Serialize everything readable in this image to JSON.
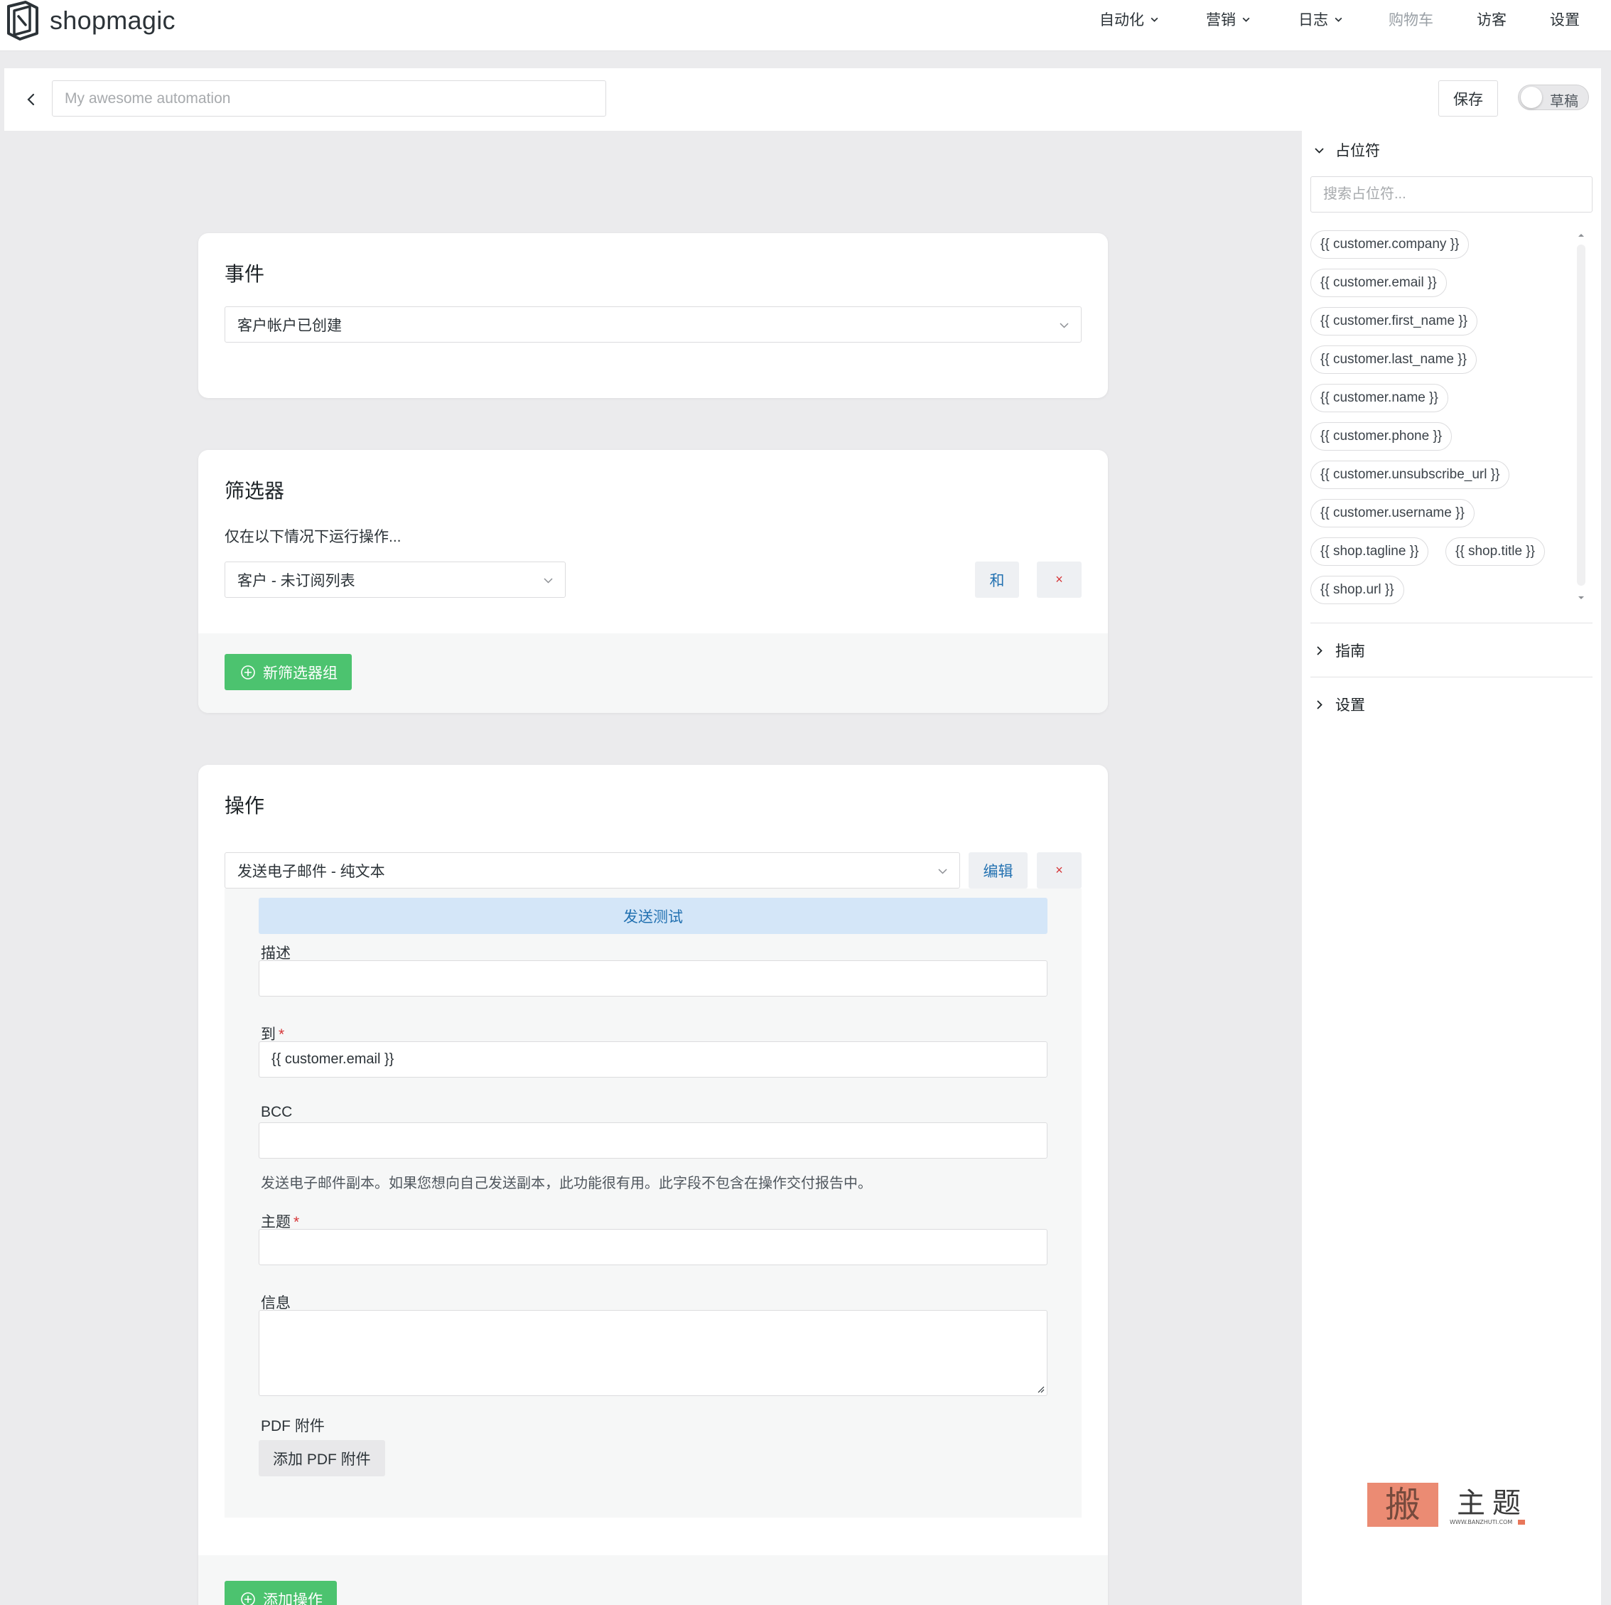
{
  "brand": {
    "name": "shopmagic"
  },
  "nav": {
    "items": [
      {
        "label": "自动化",
        "dropdown": true,
        "disabled": false
      },
      {
        "label": "营销",
        "dropdown": true,
        "disabled": false
      },
      {
        "label": "日志",
        "dropdown": true,
        "disabled": false
      },
      {
        "label": "购物车",
        "dropdown": false,
        "disabled": true
      },
      {
        "label": "访客",
        "dropdown": false,
        "disabled": false
      },
      {
        "label": "设置",
        "dropdown": false,
        "disabled": false
      }
    ]
  },
  "header": {
    "title_placeholder": "My awesome automation",
    "title_value": "",
    "save_label": "保存",
    "status_label": "草稿",
    "status_on": false
  },
  "event_card": {
    "title": "事件",
    "selected_event": "客户帐户已创建"
  },
  "filter_card": {
    "title": "筛选器",
    "intro": "仅在以下情况下运行操作...",
    "filter_selected": "客户 - 未订阅列表",
    "and_label": "和",
    "remove_label": "×",
    "add_group_label": "新筛选器组"
  },
  "action_card": {
    "title": "操作",
    "selected_action": "发送电子邮件 - 纯文本",
    "edit_label": "编辑",
    "remove_label": "×",
    "send_test_label": "发送测试",
    "fields": {
      "description": {
        "label": "描述",
        "value": ""
      },
      "to": {
        "label": "到",
        "required_mark": "*",
        "value": "{{ customer.email }}"
      },
      "bcc": {
        "label": "BCC",
        "value": "",
        "help": "发送电子邮件副本。如果您想向自己发送副本，此功能很有用。此字段不包含在操作交付报告中。"
      },
      "subject": {
        "label": "主题",
        "required_mark": "*",
        "value": ""
      },
      "message": {
        "label": "信息",
        "value": ""
      },
      "pdf": {
        "label": "PDF 附件",
        "button": "添加 PDF 附件"
      }
    },
    "add_action_label": "添加操作"
  },
  "sidebar": {
    "placeholders": {
      "title": "占位符",
      "search_placeholder": "搜索占位符...",
      "tags": [
        "{{ customer.company }}",
        "{{ customer.email }}",
        "{{ customer.first_name }}",
        "{{ customer.last_name }}",
        "{{ customer.name }}",
        "{{ customer.phone }}",
        "{{ customer.unsubscribe_url }}",
        "{{ customer.username }}",
        "{{ shop.tagline }}",
        "{{ shop.title }}",
        "{{ shop.url }}"
      ]
    },
    "guide": {
      "title": "指南"
    },
    "settings": {
      "title": "设置"
    }
  },
  "colors": {
    "accent_green": "#4cc36f",
    "link_blue": "#2271b1",
    "danger_red": "#d63638",
    "page_bg": "#ebebed"
  },
  "watermark": {
    "text": "搬主题",
    "subtext": "WWW.BANZHUTI.COM"
  }
}
